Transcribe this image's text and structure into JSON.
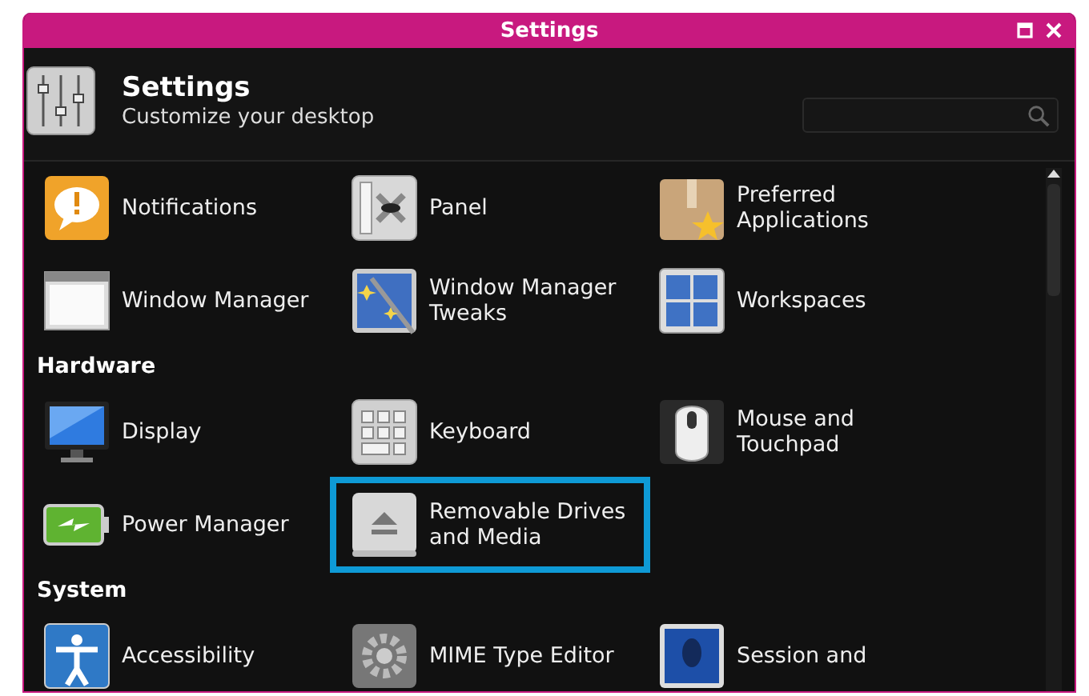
{
  "window": {
    "title": "Settings"
  },
  "header": {
    "title": "Settings",
    "subtitle": "Customize your desktop"
  },
  "sections": [
    {
      "items": [
        {
          "label": "Notifications",
          "selected": false
        },
        {
          "label": "Panel",
          "selected": false
        },
        {
          "label": "Preferred Applications",
          "selected": false
        },
        {
          "label": "Window Manager",
          "selected": false
        },
        {
          "label": "Window Manager Tweaks",
          "selected": false
        },
        {
          "label": "Workspaces",
          "selected": false
        }
      ]
    },
    {
      "title": "Hardware",
      "items": [
        {
          "label": "Display",
          "selected": false
        },
        {
          "label": "Keyboard",
          "selected": false
        },
        {
          "label": "Mouse and Touchpad",
          "selected": false
        },
        {
          "label": "Power Manager",
          "selected": false
        },
        {
          "label": "Removable Drives and Media",
          "selected": true
        }
      ]
    },
    {
      "title": "System",
      "items": [
        {
          "label": "Accessibility",
          "selected": false
        },
        {
          "label": "MIME Type Editor",
          "selected": false
        },
        {
          "label": "Session and",
          "selected": false
        }
      ]
    }
  ]
}
